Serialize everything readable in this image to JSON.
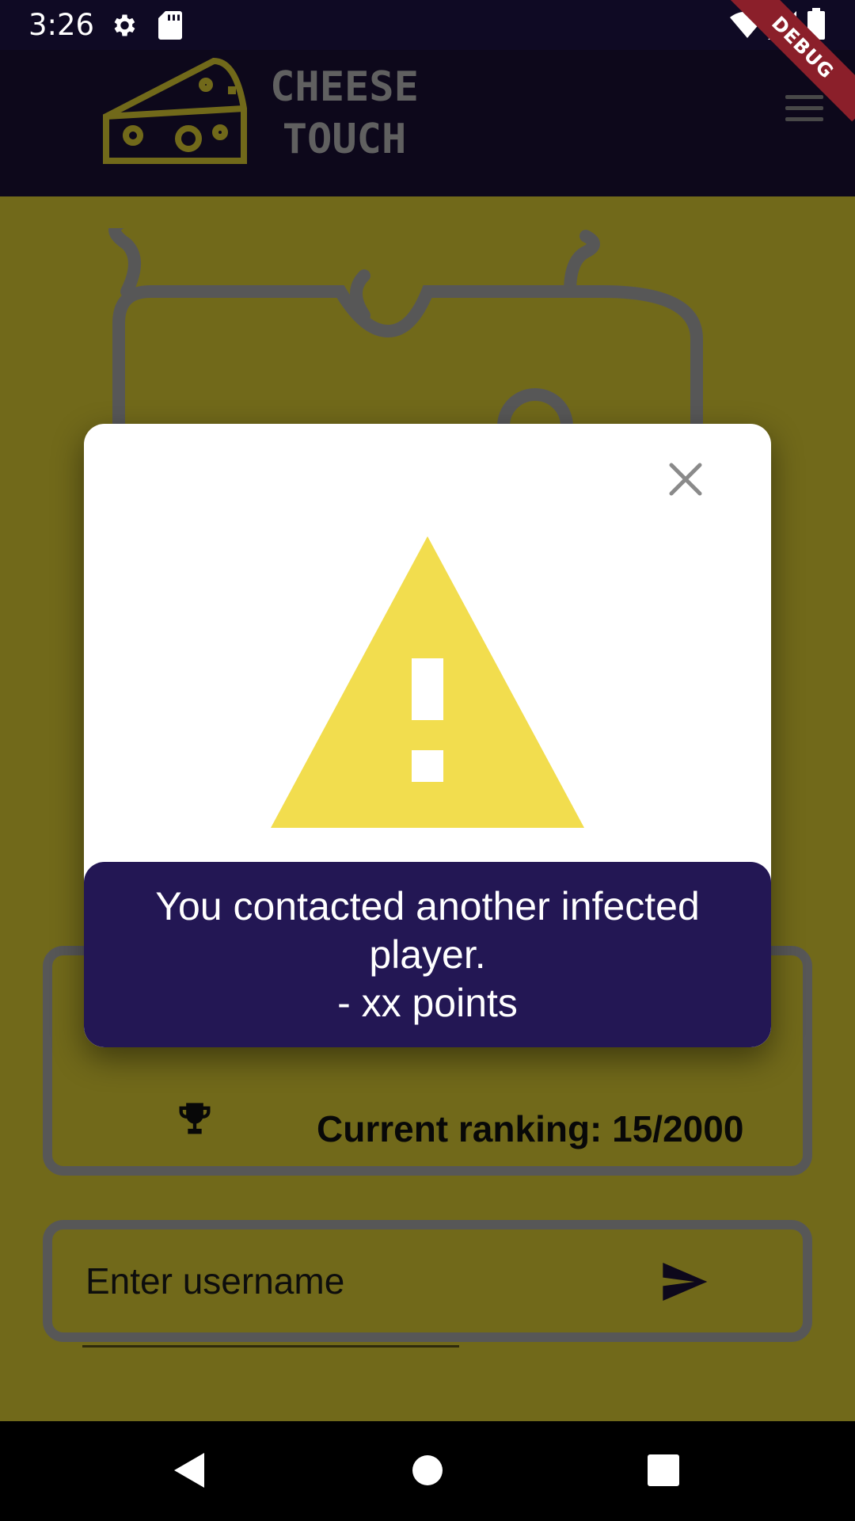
{
  "status_bar": {
    "time": "3:26",
    "icons": [
      "settings-icon",
      "sd-card-icon",
      "wifi-icon",
      "cell-signal-icon",
      "battery-icon"
    ]
  },
  "app_bar": {
    "title_line1": "CHEESE",
    "title_line2": "TOUCH",
    "logo": "cheese-logo",
    "menu_icon": "hamburger-menu-icon"
  },
  "debug_banner": {
    "label": "DEBUG"
  },
  "score_card": {
    "ranking_label": "Current ranking: 15/2000",
    "icon": "trophy-icon"
  },
  "username": {
    "placeholder": "Enter username",
    "value": "",
    "send_icon": "send-icon"
  },
  "dialog": {
    "close_icon": "close-icon",
    "warning_icon": "warning-triangle-icon",
    "message_line1": "You contacted another infected",
    "message_line2": "player.",
    "message_line3": "- xx points"
  },
  "nav_bar": {
    "items": [
      "back-icon",
      "home-icon",
      "recents-icon"
    ]
  },
  "colors": {
    "background": "#d9c932",
    "app_bar": "#1a1034",
    "dialog_footer": "#231754",
    "warning": "#f2dd4e",
    "debug_ribbon": "#8b1f2a"
  }
}
